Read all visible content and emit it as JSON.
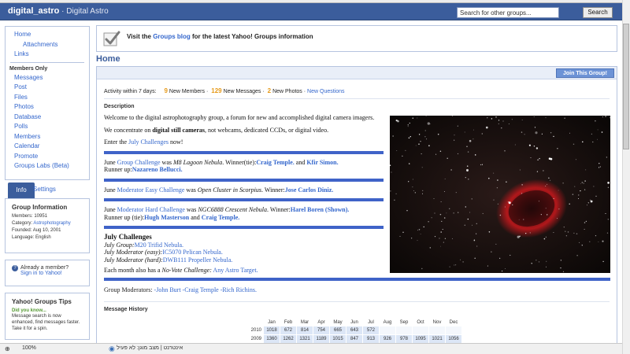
{
  "header": {
    "group_name": "digital_astro",
    "group_title": " · Digital Astro",
    "search_placeholder": "Search for other groups...",
    "search_value": "Search for other groups...",
    "search_button": "Search"
  },
  "sidebar": {
    "nav": [
      "Home",
      "Attachments",
      "Links"
    ],
    "members_only_heading": "Members Only",
    "members_items": [
      "Messages",
      "Post",
      "Files",
      "Photos",
      "Database",
      "Polls",
      "Members",
      "Calendar",
      "Promote",
      "Groups Labs (Beta)"
    ],
    "tab_info": "Info",
    "tab_settings": "Settings",
    "group_info_title": "Group Information",
    "group_info": [
      {
        "label": "Members: ",
        "value": "10951"
      },
      {
        "label": "Category: ",
        "value": "Astrophotography"
      },
      {
        "label": "Founded: ",
        "value": "Aug 10, 2001"
      },
      {
        "label": "Language: ",
        "value": "English"
      }
    ],
    "member_q": "Already a member?",
    "member_link": "Sign in to Yahoo!",
    "tips_title": "Yahoo! Groups Tips",
    "tips_dk": "Did you know...",
    "tips_text": "Message search is now enhanced, find messages faster. Take it for a spin."
  },
  "notice": {
    "pre": "Visit the ",
    "link": "Groups blog",
    "post": " for the latest Yahoo! Groups information"
  },
  "page_title": "Home",
  "join_button": "Join This Group!",
  "activity": {
    "label": "Activity within 7 days:",
    "items": [
      {
        "count": "9",
        "text": "New Members"
      },
      {
        "count": "129",
        "text": "New Messages"
      },
      {
        "count": "2",
        "text": "New Photos"
      }
    ],
    "link": "New Questions"
  },
  "description": {
    "label": "Description",
    "intro": "Welcome to the digital astrophotography group, a forum for new and accomplished digital camera imagers.",
    "concentrate_pre": "We concentrate on ",
    "concentrate_bold": "digital still cameras",
    "concentrate_post": ", not webcams, dedicated CCDs, or digital video.",
    "enter_pre": "Enter the ",
    "enter_link": "July Challenges",
    "enter_post": " now!",
    "group_challenge": {
      "pre": "June ",
      "link": "Group Challenge",
      "mid": " was ",
      "obj": "M8 Lagoon Nebula",
      "win": ". Winner(tie):",
      "w1": "Craig Temple.",
      "and": " and ",
      "w2": "Kfir Simon.",
      "ru": "Runner up:",
      "r1": "Nazareno Bellucci."
    },
    "easy_challenge": {
      "pre": "June ",
      "link": "Moderator Easy Challenge",
      "mid": " was ",
      "obj": "Open Cluster in Scorpius",
      "win": ". Winner:",
      "w1": "Jose Carlos Diniz."
    },
    "hard_challenge": {
      "pre": "June ",
      "link": "Moderator Hard Challenge",
      "mid": " was ",
      "obj": "NGC6888 Crescent Nebula",
      "win": ". Winner:",
      "w1": "Harel Boren (Shown).",
      "ru": "Runner up (tie):",
      "r1": "Hugh Masterson",
      "and": " and ",
      "r2": "Craig Temple."
    },
    "july_title": "July Challenges",
    "july": [
      {
        "label": "July Group:",
        "link": "M20 Trifid Nebula."
      },
      {
        "label": "July Moderator (easy):",
        "link": "IC5070 Pelican Nebula."
      },
      {
        "label": "July Moderator (hard):",
        "link": "DWB111 Propeller Nebula."
      }
    ],
    "novote_pre": "Each month also has a ",
    "novote_em": "No-Vote Challenge:",
    "novote_link": " Any Astro Target."
  },
  "moderators": {
    "label": "Group Moderators: ",
    "names": [
      "-John Burt ",
      "-Craig Temple ",
      "-Rich Richins."
    ]
  },
  "history": {
    "label": "Message History",
    "months": [
      "Jan",
      "Feb",
      "Mar",
      "Apr",
      "May",
      "Jun",
      "Jul",
      "Aug",
      "Sep",
      "Oct",
      "Nov",
      "Dec"
    ],
    "rows": [
      {
        "year": "2010",
        "values": [
          "1018",
          "672",
          "814",
          "754",
          "665",
          "643",
          "572",
          "",
          "",
          "",
          "",
          ""
        ]
      },
      {
        "year": "2009",
        "values": [
          "1360",
          "1262",
          "1321",
          "1189",
          "1015",
          "847",
          "913",
          "926",
          "978",
          "1095",
          "1021",
          "1056"
        ]
      }
    ]
  },
  "statusbar": {
    "zoom": "100%",
    "zone": "אינטרנט | מצב מוגן: לא פעיל"
  }
}
